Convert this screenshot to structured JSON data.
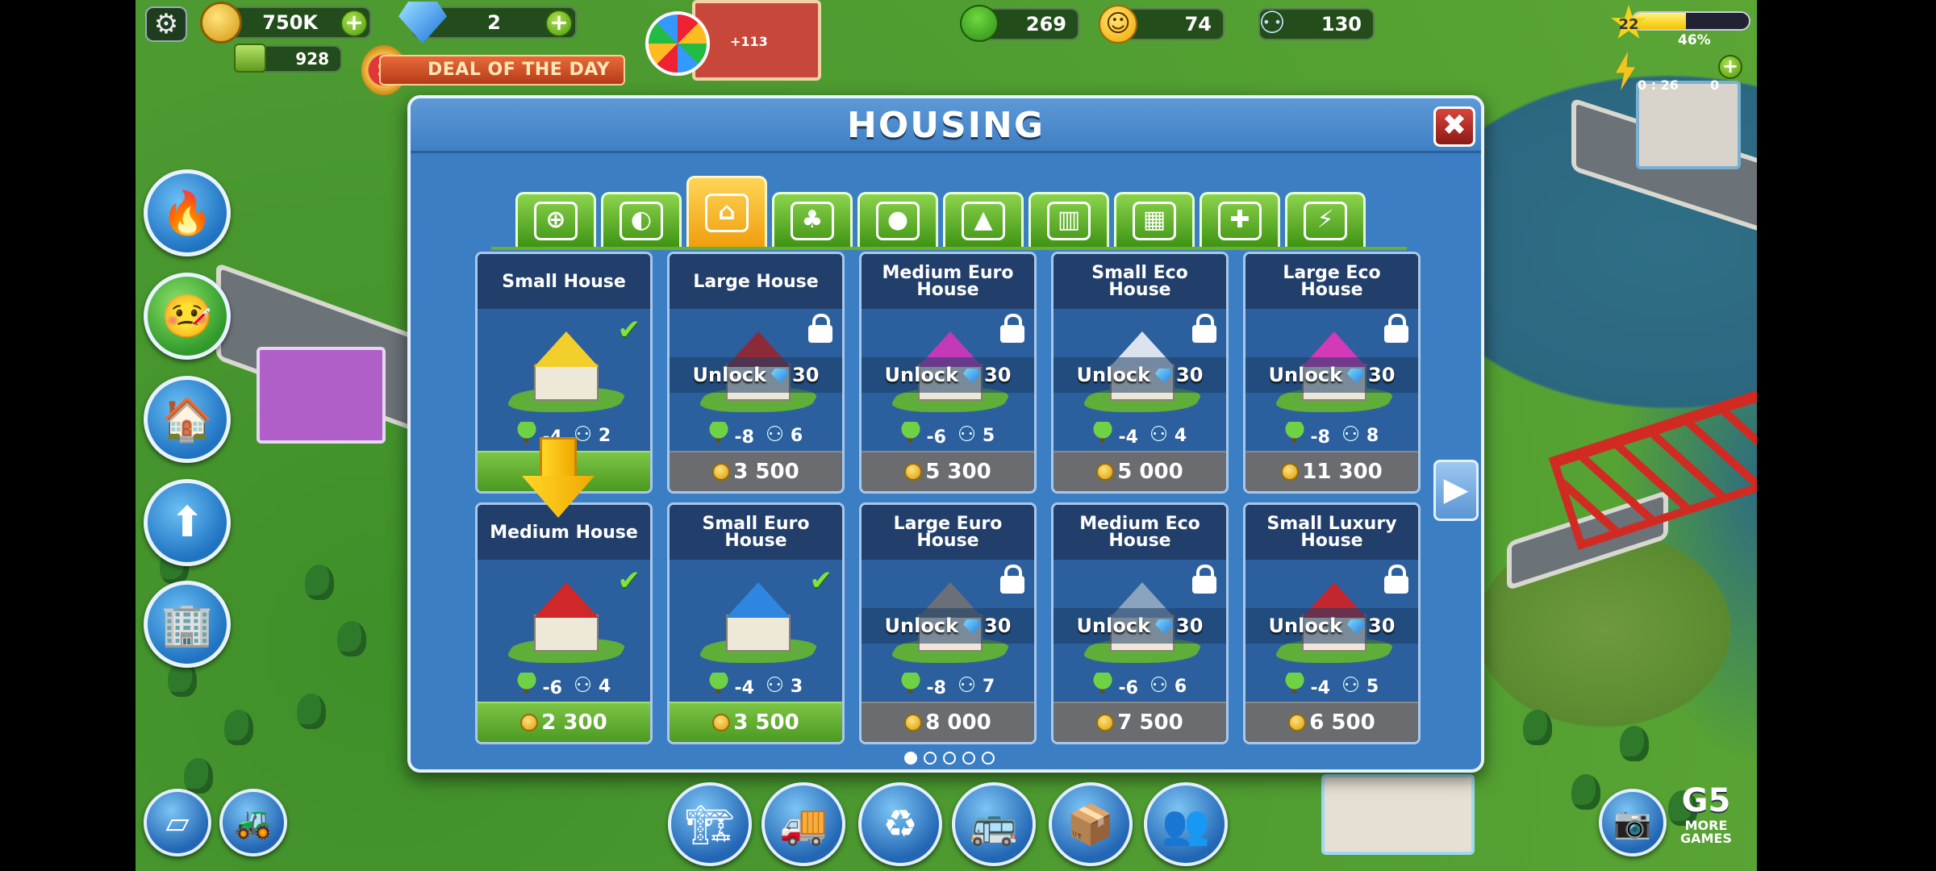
{
  "hud": {
    "coins": "750K",
    "gems": "2",
    "cash": "928",
    "ecology": "269",
    "happiness": "74",
    "population": "130",
    "level": "22",
    "xp_percent": "46%",
    "timer": "0 : 26",
    "energy": "0",
    "wheel_bonus": "+113"
  },
  "deal": {
    "label": "DEAL OF THE DAY",
    "badge": "$"
  },
  "dialog": {
    "title": "HOUSING",
    "close_glyph": "✖",
    "next_glyph": "▶",
    "unlock_label": "Unlock",
    "unlock_cost": "30",
    "tabs": [
      {
        "name": "tab-documents",
        "glyph": "⊕"
      },
      {
        "name": "tab-decorations",
        "glyph": "◐"
      },
      {
        "name": "tab-housing",
        "glyph": "⌂"
      },
      {
        "name": "tab-parks",
        "glyph": "♣"
      },
      {
        "name": "tab-leisure",
        "glyph": "●"
      },
      {
        "name": "tab-landmarks",
        "glyph": "▲"
      },
      {
        "name": "tab-municipal",
        "glyph": "▥"
      },
      {
        "name": "tab-industry",
        "glyph": "▦"
      },
      {
        "name": "tab-services",
        "glyph": "✚"
      },
      {
        "name": "tab-utilities",
        "glyph": "⚡"
      }
    ],
    "active_tab": 2,
    "cards": [
      {
        "title": "Small House",
        "eco": "-4",
        "pop": "2",
        "price": "",
        "state": "owned",
        "roof": "#f2cf2a"
      },
      {
        "title": "Large House",
        "eco": "-8",
        "pop": "6",
        "price": "3 500",
        "state": "locked",
        "roof": "#8c2a38"
      },
      {
        "title": "Medium Euro House",
        "eco": "-6",
        "pop": "5",
        "price": "5 300",
        "state": "locked",
        "roof": "#c23ab8"
      },
      {
        "title": "Small Eco House",
        "eco": "-4",
        "pop": "4",
        "price": "5 000",
        "state": "locked",
        "roof": "#dbe4ee"
      },
      {
        "title": "Large Eco House",
        "eco": "-8",
        "pop": "8",
        "price": "11 300",
        "state": "locked",
        "roof": "#d23ab8"
      },
      {
        "title": "Medium House",
        "eco": "-6",
        "pop": "4",
        "price": "2 300",
        "state": "owned",
        "roof": "#d02828"
      },
      {
        "title": "Small Euro House",
        "eco": "-4",
        "pop": "3",
        "price": "3 500",
        "state": "owned",
        "roof": "#2f86e0"
      },
      {
        "title": "Large Euro House",
        "eco": "-8",
        "pop": "7",
        "price": "8 000",
        "state": "locked",
        "roof": "#6b7078"
      },
      {
        "title": "Medium Eco House",
        "eco": "-6",
        "pop": "6",
        "price": "7 500",
        "state": "locked",
        "roof": "#8aa4c0"
      },
      {
        "title": "Small Luxury House",
        "eco": "-4",
        "pop": "5",
        "price": "6 500",
        "state": "locked",
        "roof": "#c42630"
      }
    ],
    "page_count": 5,
    "current_page": 0
  },
  "bottom": {
    "more_games": "MORE GAMES",
    "g5": "G5"
  },
  "colors": {
    "dialog_bg": "#3c7ec4",
    "tab_green": "#5cb02a",
    "tab_active": "#f6b820",
    "price_owned": "#5ca82c",
    "price_locked": "#6a6c70"
  }
}
